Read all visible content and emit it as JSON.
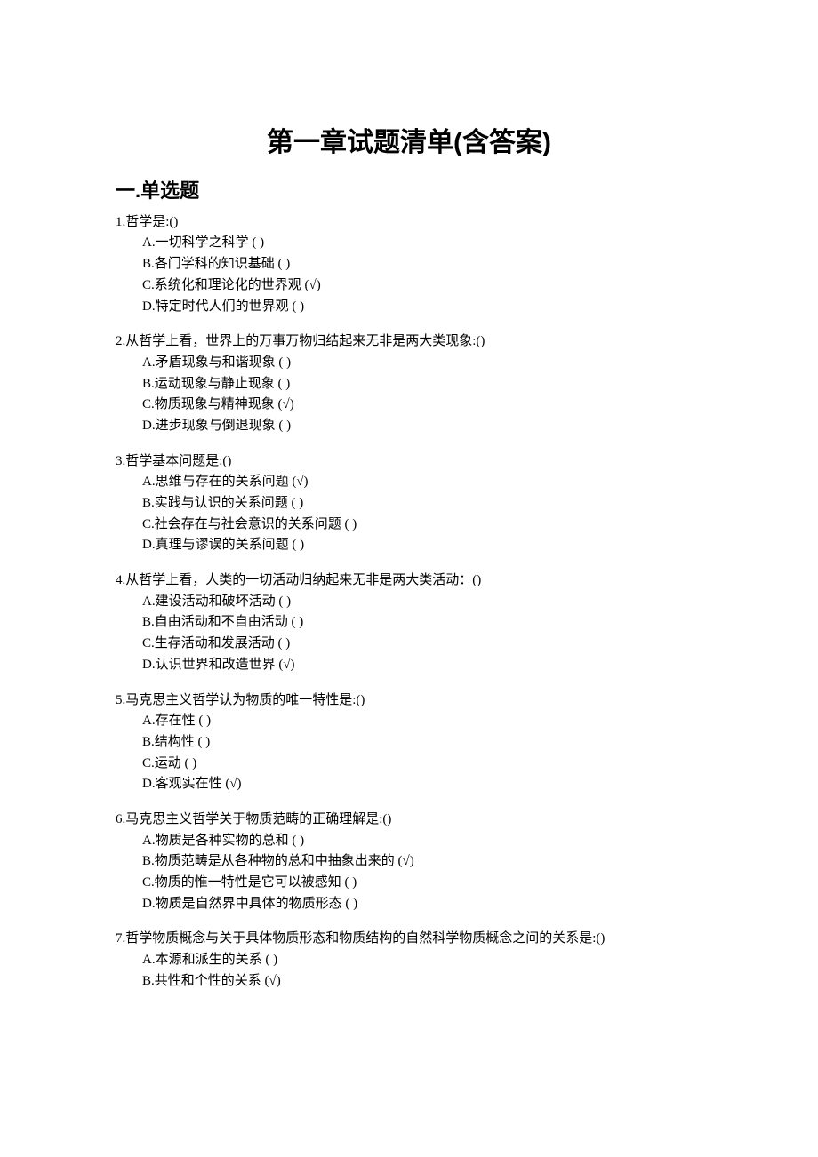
{
  "title": "第一章试题清单(含答案)",
  "section_heading": "一.单选题",
  "questions": [
    {
      "stem": "1.哲学是:()",
      "options": [
        "A.一切科学之科学 ( )",
        "B.各门学科的知识基础 ( )",
        "C.系统化和理论化的世界观 (√)",
        "D.特定时代人们的世界观 ( )"
      ]
    },
    {
      "stem": "2.从哲学上看，世界上的万事万物归结起来无非是两大类现象:()",
      "options": [
        "A.矛盾现象与和谐现象 ( )",
        "B.运动现象与静止现象 ( )",
        "C.物质现象与精神现象 (√)",
        "D.进步现象与倒退现象 ( )"
      ]
    },
    {
      "stem": "3.哲学基本问题是:()",
      "options": [
        "A.思维与存在的关系问题 (√)",
        "B.实践与认识的关系问题 ( )",
        "C.社会存在与社会意识的关系问题 ( )",
        "D.真理与谬误的关系问题 ( )"
      ]
    },
    {
      "stem": "4.从哲学上看，人类的一切活动归纳起来无非是两大类活动：()",
      "options": [
        "A.建设活动和破坏活动 ( )",
        "B.自由活动和不自由活动 ( )",
        "C.生存活动和发展活动 ( )",
        "D.认识世界和改造世界 (√)"
      ]
    },
    {
      "stem": "5.马克思主义哲学认为物质的唯一特性是:()",
      "options": [
        "A.存在性 ( )",
        "B.结构性 ( )",
        "C.运动 ( )",
        "D.客观实在性 (√)"
      ]
    },
    {
      "stem": "6.马克思主义哲学关于物质范畴的正确理解是:()",
      "options": [
        "A.物质是各种实物的总和 ( )",
        "B.物质范畴是从各种物的总和中抽象出来的 (√)",
        "C.物质的惟一特性是它可以被感知 ( )",
        "D.物质是自然界中具体的物质形态 ( )"
      ]
    },
    {
      "stem": "7.哲学物质概念与关于具体物质形态和物质结构的自然科学物质概念之间的关系是:()",
      "options": [
        "A.本源和派生的关系 ( )",
        "B.共性和个性的关系 (√)"
      ]
    }
  ]
}
